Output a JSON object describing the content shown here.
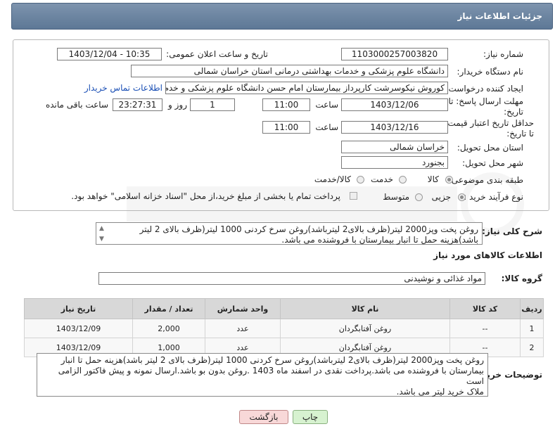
{
  "header": {
    "title": "جزئیات اطلاعات نیاز"
  },
  "form": {
    "need_number_label": "شماره نیاز:",
    "need_number": "1103000257003820",
    "announce_label": "تاریخ و ساعت اعلان عمومی:",
    "announce_value": "1403/12/04 - 10:35",
    "buyer_org_label": "نام دستگاه خریدار:",
    "buyer_org": "دانشگاه علوم پزشکی و خدمات بهداشتی درمانی استان خراسان شمالی",
    "requester_label": "ایجاد کننده درخواست:",
    "requester": "کوروش نیکوسرشت کارپرداز بیمارستان امام حسن دانشگاه علوم پزشکی و خدم",
    "contact_link": "اطلاعات تماس خریدار",
    "reply_deadline_label": "مهلت ارسال پاسخ: تا تاریخ:",
    "reply_date": "1403/12/06",
    "time_label": "ساعت",
    "reply_time": "11:00",
    "days": "1",
    "days_label": "روز و",
    "remaining_time": "23:27:31",
    "remaining_label": "ساعت باقی مانده",
    "price_validity_label": "حداقل تاریخ اعتبار قیمت: تا تاریخ:",
    "price_date": "1403/12/16",
    "price_time": "11:00",
    "province_label": "استان محل تحویل:",
    "province": "خراسان شمالی",
    "city_label": "شهر محل تحویل:",
    "city": "بجنورد",
    "category_label": "طبقه بندی موضوعی:",
    "category_options": [
      "کالا",
      "خدمت",
      "کالا/خدمت"
    ],
    "process_label": "نوع فرآیند خرید :",
    "process_options": [
      "جزیی",
      "متوسط"
    ],
    "payment_note": "پرداخت تمام یا بخشی از مبلغ خرید،از محل \"اسناد خزانه اسلامی\" خواهد بود."
  },
  "summary": {
    "label": "شرح کلی نیاز:",
    "text": "روغن پخت وپز2000 لیتر(ظرف بالای2 لیترباشد)روغن سرخ کردنی 1000 لیتر(ظرف بالای 2 لیتر باشد)هزینه حمل تا انبار بیمارستان با فروشنده می باشد."
  },
  "goods": {
    "section_title": "اطلاعات کالاهای مورد نیاز",
    "group_label": "گروه کالا:",
    "group_value": "مواد غذائی و نوشیدنی",
    "columns": [
      "ردیف",
      "کد کالا",
      "نام کالا",
      "واحد شمارش",
      "تعداد / مقدار",
      "تاریخ نیاز"
    ],
    "rows": [
      [
        "1",
        "--",
        "روغن آفتابگردان",
        "عدد",
        "2,000",
        "1403/12/09"
      ],
      [
        "2",
        "--",
        "روغن آفتابگردان",
        "عدد",
        "1,000",
        "1403/12/09"
      ]
    ]
  },
  "buyer_notes": {
    "label": "توضیحات خریدار:",
    "line1": "روغن پخت وپز2000 لیتر(ظرف بالای2 لیترباشد)روغن سرخ کردنی 1000 لیتر(ظرف بالای 2 لیتر باشد)هزینه حمل تا انبار",
    "line2": "بیمارستان با فروشنده می باشد.پرداخت نقدی در اسفند ماه 1403 .روغن بدون بو باشد.ارسال نمونه و پیش فاکتور الزامی",
    "line3": "است",
    "line4": "ملاک خرید لیتر می باشد."
  },
  "buttons": {
    "print": "چاپ",
    "back": "بازگشت"
  }
}
